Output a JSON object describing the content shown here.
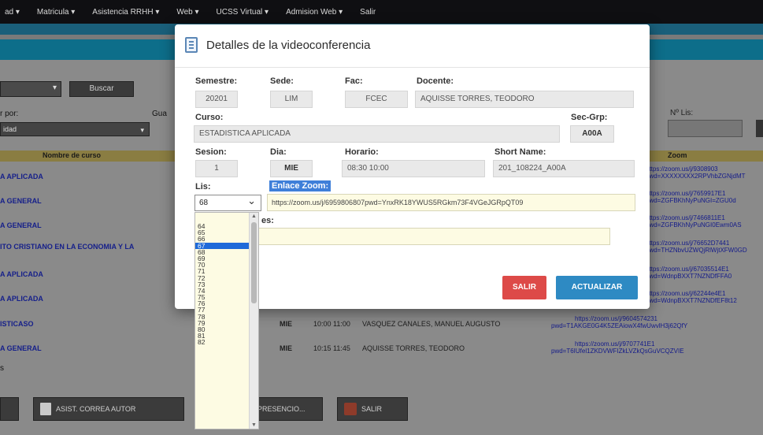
{
  "nav": {
    "items": [
      "ad ▾",
      "Matricula ▾",
      "Asistencia RRHH ▾",
      "Web ▾",
      "UCSS Virtual ▾",
      "Admision Web ▾",
      "Salir"
    ]
  },
  "filters": {
    "buscar_label": "Buscar",
    "por_label": "r por:",
    "gua_label": "Gua",
    "tipo_value": "idad",
    "nlis_label": "Nº Lis:"
  },
  "table": {
    "headers": {
      "curso": "Nombre de curso",
      "zoom": "Zoom"
    },
    "courses": [
      "A APLICADA",
      "A GENERAL",
      "A GENERAL",
      "ITO CRISTIANO EN LA ECONOMIA Y LA",
      "A APLICADA",
      "A APLICADA",
      "ISTICASO",
      "A GENERAL"
    ],
    "zoom_links": [
      [
        "https://zoom.us/j/9308903",
        "pwd=XXXXXXXX2RPVhbZGNjdMT"
      ],
      [
        "https://zoom.us/j/7659917E1",
        "pwd=ZGFBKhNyPuNGI=ZGU0d"
      ],
      [
        "https://zoom.us/j/7466811E1",
        "pwd=ZGFBKhNyPuNGI0Ewm0AS"
      ],
      [
        "https://zoom.us/j/76652D7441",
        "pwd=THZNbvUZWQjRlWjtXFW0GD"
      ],
      [
        "https://zoom.us/j/67035514E1",
        "pwd=WdnpBXXT7NZNDfFFA0"
      ],
      [
        "https://zoom.us/j/62244e4E1",
        "pwd=WdnpBXXT7NZNDfEF8t12"
      ]
    ],
    "row_a": {
      "day": "MIE",
      "time": "10:00 11:00",
      "teacher": "VASQUEZ CANALES, MANUEL AUGUSTO",
      "zoom1": "https://zoom.us/j/9604574231",
      "zoom2": "pwd=T1AKGE0G4K5ZEAiowX4fwUwvlH3j62QfY"
    },
    "row_b": {
      "day": "MIE",
      "time": "10:15 11:45",
      "teacher": "AQUISSE TORRES, TEODORO",
      "zoom1": "https://zoom.us/j/9707741E1",
      "zoom2": "pwd=T6IUfel1ZKDVWFIZkLVZkQsGuVCQZVIE"
    },
    "small_label": "s"
  },
  "bottom": {
    "btn1": "",
    "btn2": "ASIST. CORREA AUTOR",
    "btn3": "PRESENCIO...",
    "btn4": "SALIR"
  },
  "modal": {
    "title": "Detalles de la videoconferencia",
    "semestre_label": "Semestre:",
    "semestre_value": "20201",
    "sede_label": "Sede:",
    "sede_value": "LIM",
    "fac_label": "Fac:",
    "fac_value": "FCEC",
    "docente_label": "Docente:",
    "docente_value": "AQUISSE TORRES, TEODORO",
    "curso_label": "Curso:",
    "curso_value": "ESTADISTICA APLICADA",
    "secgrp_label": "Sec-Grp:",
    "secgrp_value": "A00A",
    "sesion_label": "Sesion:",
    "sesion_value": "1",
    "dia_label": "Dia:",
    "dia_value": "MIE",
    "horario_label": "Horario:",
    "horario_value": "08:30 10:00",
    "shortname_label": "Short Name:",
    "shortname_value": "201_108224_A00A",
    "lis_label": "Lis:",
    "lis_value": "68",
    "zoom_label": "Enlace Zoom:",
    "zoom_value": "https://zoom.us/j/6959806807pwd=YnxRK18YWUS5RGkm73F4VGeJGRpQT09",
    "obs_label": "es:",
    "salir_label": "SALIR",
    "actualizar_label": "ACTUALIZAR"
  },
  "dropdown": {
    "options": [
      "64",
      "65",
      "66",
      "67",
      "68",
      "69",
      "70",
      "71",
      "72",
      "73",
      "74",
      "75",
      "76",
      "77",
      "78",
      "79",
      "80",
      "81",
      "82"
    ],
    "selected": "67"
  }
}
